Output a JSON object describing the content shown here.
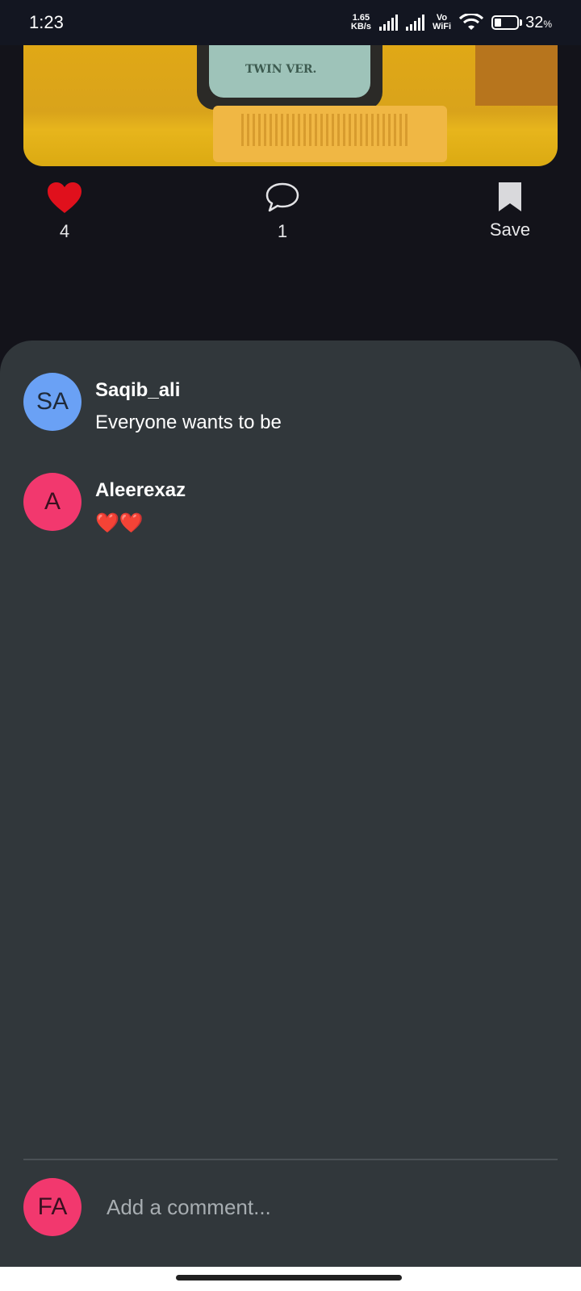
{
  "status_bar": {
    "time": "1:23",
    "net_speed_value": "1.65",
    "net_speed_unit": "KB/s",
    "vowifi_top": "Vo",
    "vowifi_bottom": "WiFi",
    "battery_percent": "32",
    "battery_unit": "%",
    "battery_level": 0.32
  },
  "post": {
    "image_text": "TWIN VER.",
    "likes": "4",
    "comments": "1",
    "save_label": "Save",
    "like_color": "#e0101c"
  },
  "comments": [
    {
      "initials": "SA",
      "avatar_color": "#6aa1f5",
      "avatar_text_color": "#1f2a3a",
      "username": "Saqib_ali",
      "text": "Everyone wants to be"
    },
    {
      "initials": "A",
      "avatar_color": "#f2386e",
      "avatar_text_color": "#3a1020",
      "username": "Aleerexaz",
      "text": "❤️❤️"
    }
  ],
  "composer": {
    "initials": "FA",
    "avatar_color": "#f2386e",
    "placeholder": "Add a comment..."
  }
}
